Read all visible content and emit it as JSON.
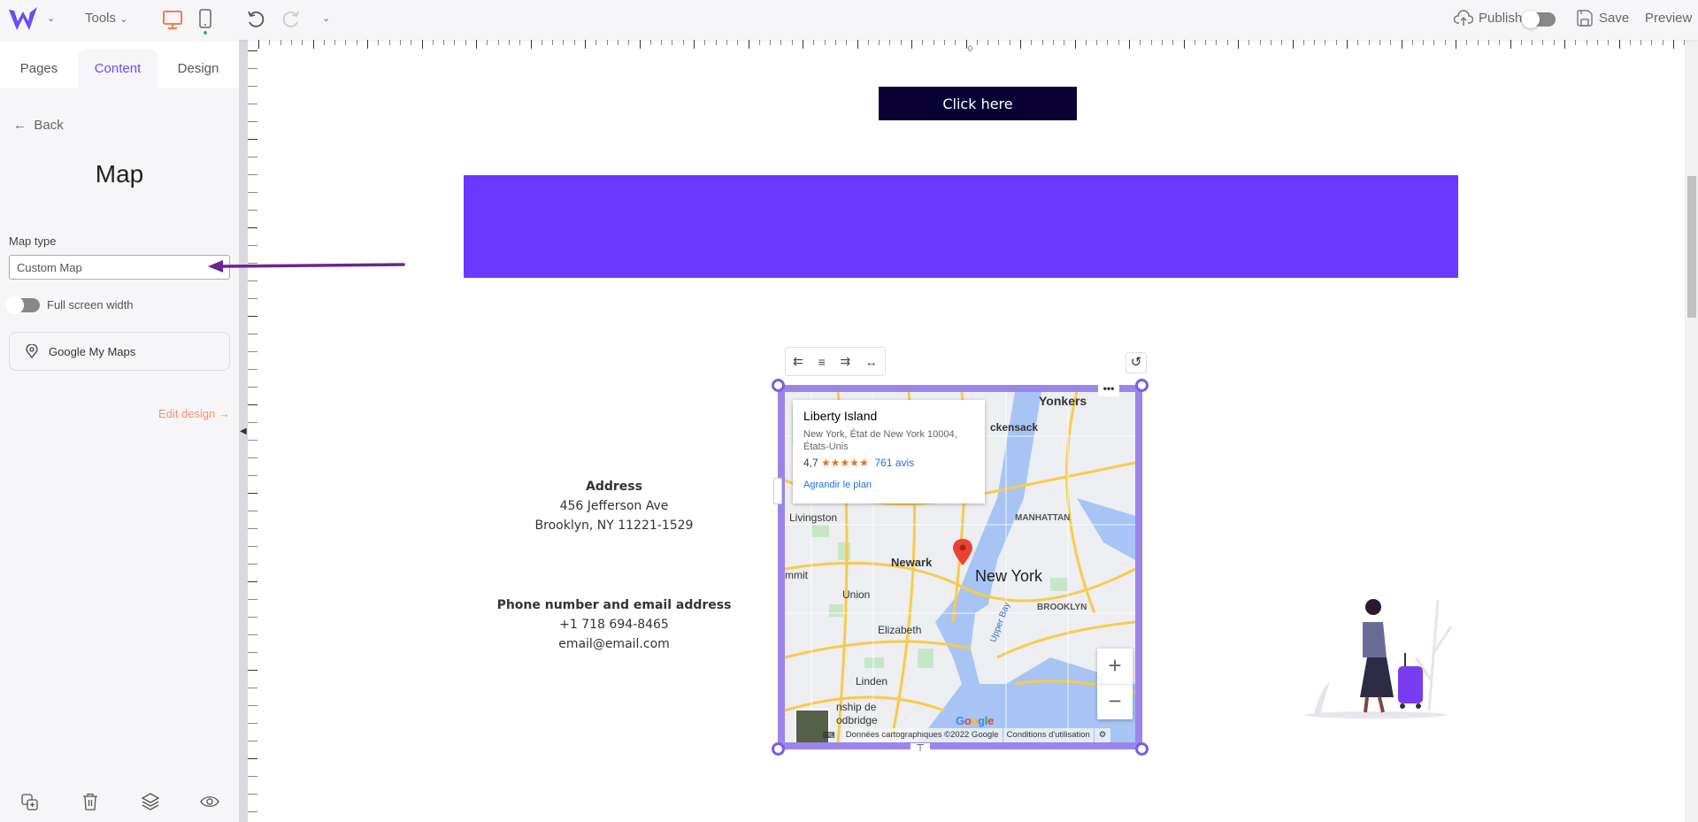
{
  "topbar": {
    "tools_label": "Tools",
    "publish_label": "Publish",
    "save_label": "Save",
    "preview_label": "Preview",
    "brand_color": "#6a4cf5",
    "accent_color": "#ff7a45"
  },
  "sidebar": {
    "tabs": [
      {
        "label": "Pages"
      },
      {
        "label": "Content",
        "active": true
      },
      {
        "label": "Design"
      }
    ],
    "back_label": "Back",
    "title": "Map",
    "map_type_label": "Map type",
    "map_type_value": "Custom Map",
    "full_width_label": "Full screen width",
    "full_width_on": false,
    "google_my_maps_label": "Google My Maps",
    "edit_design_label": "Edit design"
  },
  "canvas": {
    "ruler_zero": "0",
    "button_label": "Click here",
    "banner_color": "#6a38ff",
    "address_heading": "Address",
    "address_line1": "456 Jefferson Ave",
    "address_line2": "Brooklyn, NY 11221-1529",
    "contact_heading": "Phone number and email address",
    "phone": "+1 718 694-8465",
    "email": "email@email.com"
  },
  "map": {
    "place_name": "Liberty Island",
    "place_address": "New York, État de New York 10004, États-Unis",
    "rating": "4,7",
    "stars": 4.7,
    "reviews": "761 avis",
    "enlarge": "Agrandir le plan",
    "labels": [
      "Yonkers",
      "ckensack",
      "Livingston",
      "Newark",
      "New York",
      "MANHATTAN",
      "BROOKLYN",
      "Union",
      "Elizabeth",
      "Linden",
      "mmit",
      "nship de",
      "odbridge",
      "Upper Bay"
    ],
    "attribution": "Données cartographiques ©2022 Google",
    "terms": "Conditions d'utilisation",
    "google_logo": "Google"
  }
}
